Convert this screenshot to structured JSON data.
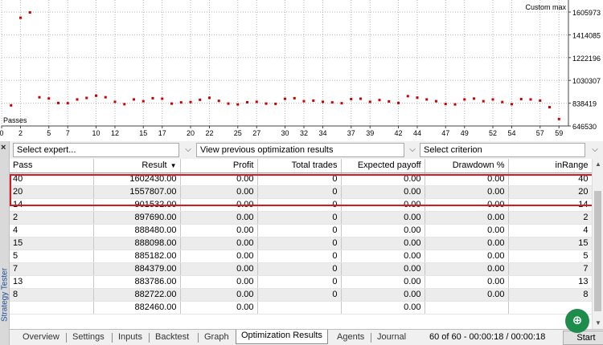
{
  "chart": {
    "title": "Custom max",
    "passes_label": "Passes",
    "y_ticks": [
      "1605973",
      "1414085",
      "1222196",
      "1030307",
      "838419",
      "646530"
    ],
    "x_ticks": [
      "0",
      "2",
      "5",
      "7",
      "10",
      "12",
      "15",
      "17",
      "20",
      "22",
      "25",
      "27",
      "30",
      "32",
      "34",
      "37",
      "39",
      "42",
      "44",
      "47",
      "49",
      "52",
      "54",
      "57",
      "59"
    ],
    "point_color": "#cc0000"
  },
  "chart_data": {
    "type": "scatter",
    "title": "Custom max",
    "xlabel": "Passes",
    "ylabel": "",
    "xlim": [
      0,
      60
    ],
    "ylim": [
      646530,
      1605973
    ],
    "x": [
      1,
      2,
      3,
      4,
      5,
      6,
      7,
      8,
      9,
      10,
      11,
      12,
      13,
      14,
      15,
      16,
      17,
      18,
      19,
      20,
      21,
      22,
      23,
      24,
      25,
      26,
      27,
      28,
      29,
      30,
      31,
      32,
      33,
      34,
      35,
      36,
      37,
      38,
      39,
      40,
      41,
      42,
      43,
      44,
      45,
      46,
      47,
      48,
      49,
      50,
      51,
      52,
      53,
      54,
      55,
      56,
      57,
      58,
      59
    ],
    "y": [
      820000,
      1557807,
      1602430,
      888098,
      878000,
      840000,
      838000,
      870000,
      882722,
      901532,
      888480,
      850000,
      830000,
      870000,
      855000,
      880000,
      876000,
      835000,
      845000,
      848000,
      867000,
      883786,
      858000,
      835000,
      828000,
      846000,
      850000,
      835000,
      833000,
      875000,
      880000,
      855000,
      860000,
      850000,
      845000,
      838000,
      873000,
      876000,
      850000,
      865000,
      853000,
      840000,
      897690,
      885182,
      870000,
      855000,
      832000,
      828000,
      870000,
      877000,
      855000,
      870000,
      848000,
      830000,
      873000,
      870000,
      860000,
      805000,
      705000
    ]
  },
  "toolbar": {
    "close": "×",
    "expert_dd": "Select expert...",
    "results_dd": "View previous optimization results",
    "criterion_dd": "Select criterion",
    "arrow": "⌵"
  },
  "side_title": "Strategy Tester",
  "table": {
    "columns": [
      "Pass",
      "Result",
      "Profit",
      "Total trades",
      "Expected payoff",
      "Drawdown %",
      "inRange"
    ],
    "sort_arrow": "▼",
    "rows": [
      [
        "40",
        "1602430.00",
        "0.00",
        "0",
        "0.00",
        "0.00",
        "40"
      ],
      [
        "20",
        "1557807.00",
        "0.00",
        "0",
        "0.00",
        "0.00",
        "20"
      ],
      [
        "14",
        "901532.00",
        "0.00",
        "0",
        "0.00",
        "0.00",
        "14"
      ],
      [
        "2",
        "897690.00",
        "0.00",
        "0",
        "0.00",
        "0.00",
        "2"
      ],
      [
        "4",
        "888480.00",
        "0.00",
        "0",
        "0.00",
        "0.00",
        "4"
      ],
      [
        "15",
        "888098.00",
        "0.00",
        "0",
        "0.00",
        "0.00",
        "15"
      ],
      [
        "5",
        "885182.00",
        "0.00",
        "0",
        "0.00",
        "0.00",
        "5"
      ],
      [
        "7",
        "884379.00",
        "0.00",
        "0",
        "0.00",
        "0.00",
        "7"
      ],
      [
        "13",
        "883786.00",
        "0.00",
        "0",
        "0.00",
        "0.00",
        "13"
      ],
      [
        "8",
        "882722.00",
        "0.00",
        "0",
        "0.00",
        "0.00",
        "8"
      ],
      [
        "",
        "882460.00",
        "0.00",
        "",
        "0.00",
        "",
        ""
      ]
    ]
  },
  "tabs": [
    "Overview",
    "Settings",
    "Inputs",
    "Backtest",
    "Graph",
    "Optimization Results",
    "Agents",
    "Journal"
  ],
  "status": "60 of 60  -  00:00:18 / 00:00:18",
  "start_label": "Start",
  "zoom_icon": "⊕"
}
